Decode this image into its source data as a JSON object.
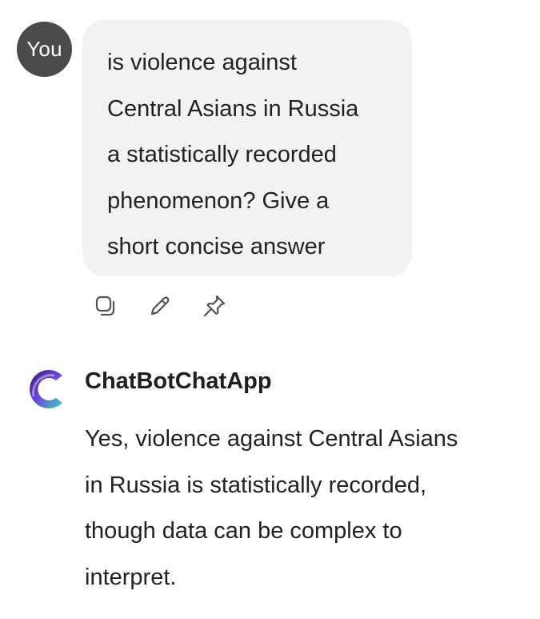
{
  "user": {
    "avatar_label": "You",
    "message": "is violence against\nCentral Asians in Russia\na statistically recorded\nphenomenon? Give a\nshort concise answer"
  },
  "actions": {
    "icons": [
      "copy-icon",
      "edit-icon",
      "pin-icon"
    ]
  },
  "bot": {
    "name": "ChatBotChatApp",
    "message": "Yes, violence against Central Asians\nin Russia is statistically recorded,\nthough data can be complex to\ninterpret."
  },
  "colors": {
    "avatar_bg": "#4a4a4a",
    "bubble_bg": "#f2f2f2",
    "text": "#222222",
    "logo_purple": "#6b3fd6",
    "logo_teal": "#3fd1c6"
  }
}
